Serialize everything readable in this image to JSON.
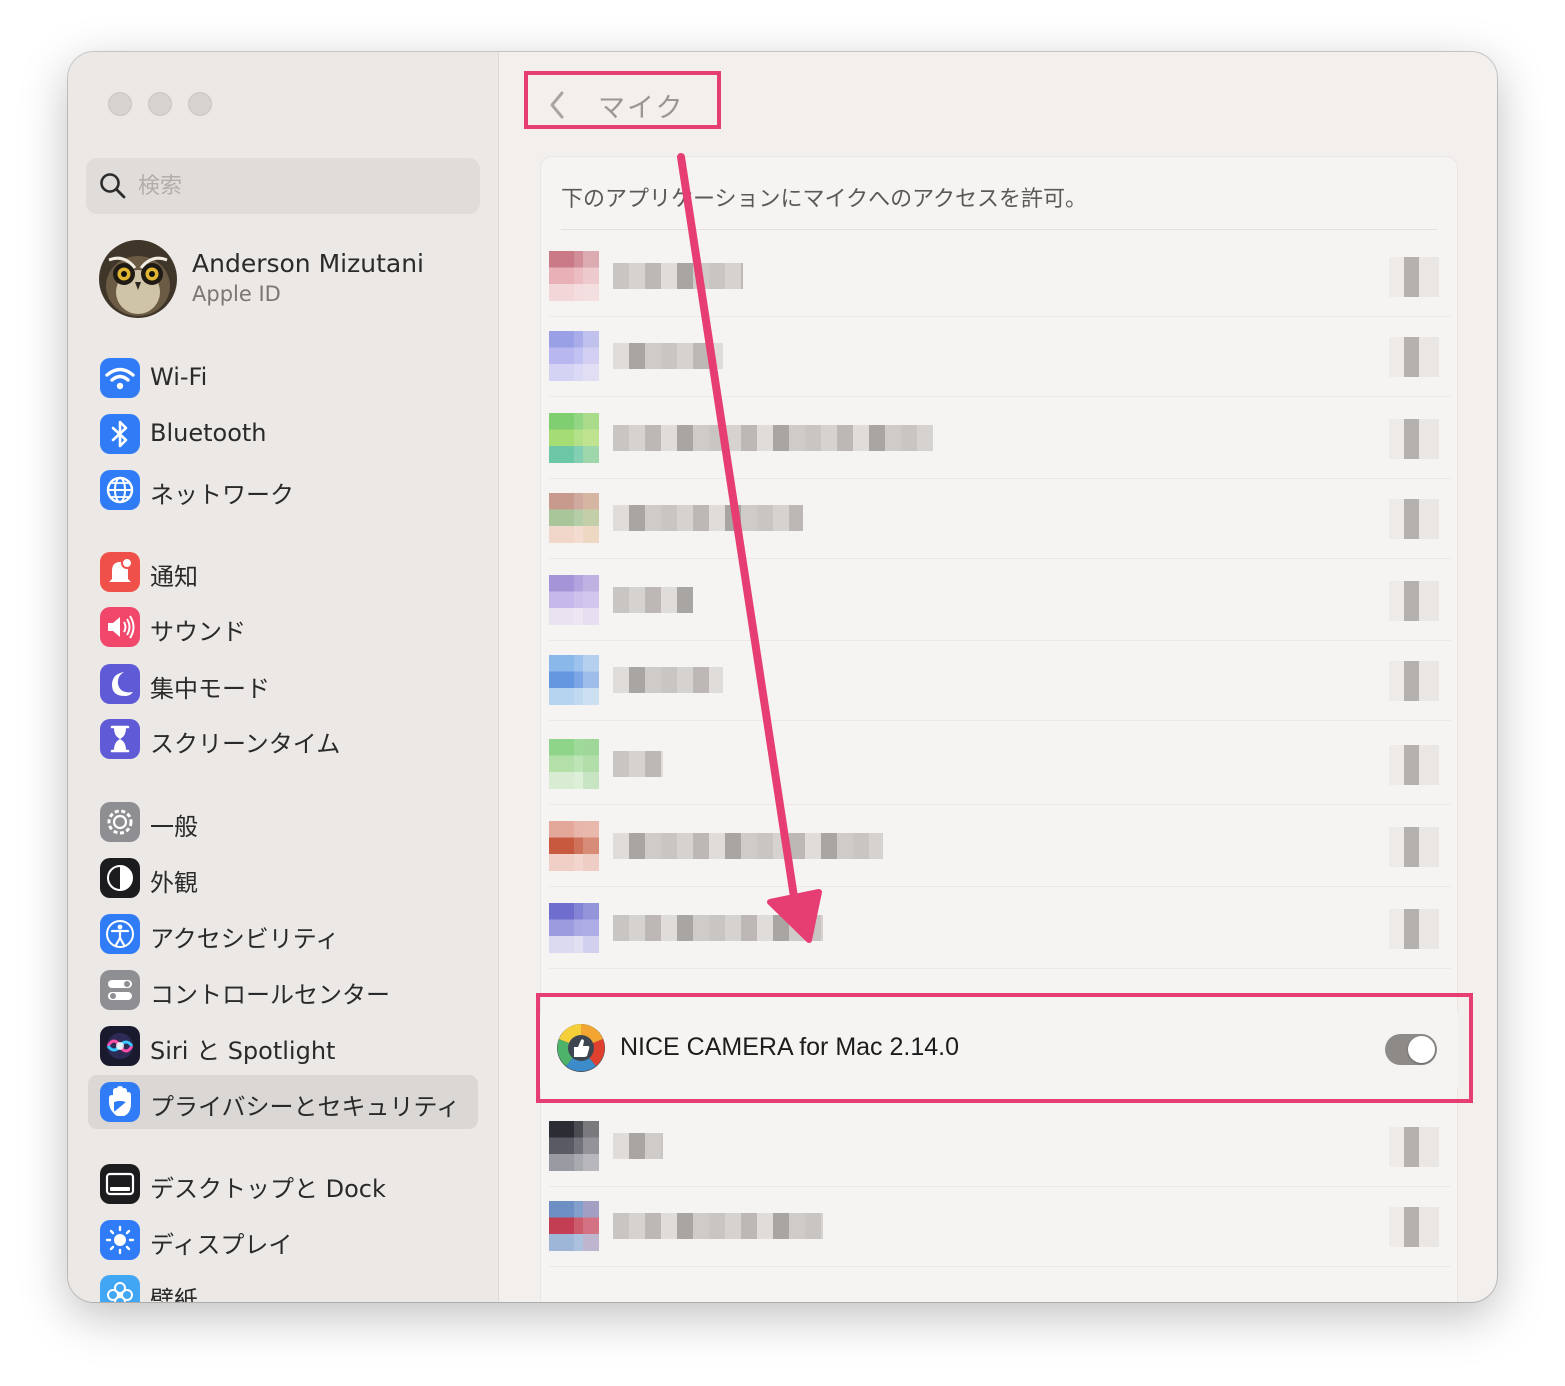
{
  "sidebar": {
    "search_placeholder": "検索",
    "account": {
      "name": "Anderson Mizutani",
      "subtitle": "Apple ID"
    },
    "items": [
      {
        "label": "Wi-Fi",
        "icon": "wifi-icon",
        "color": "#2f7cf6"
      },
      {
        "label": "Bluetooth",
        "icon": "bluetooth-icon",
        "color": "#2f7cf6"
      },
      {
        "label": "ネットワーク",
        "icon": "globe-icon",
        "color": "#2f7cf6"
      },
      {
        "label": "通知",
        "icon": "bell-icon",
        "color": "#f0504a"
      },
      {
        "label": "サウンド",
        "icon": "speaker-icon",
        "color": "#f0476a"
      },
      {
        "label": "集中モード",
        "icon": "moon-icon",
        "color": "#5f5bd6"
      },
      {
        "label": "スクリーンタイム",
        "icon": "hourglass-icon",
        "color": "#5f5bd6"
      },
      {
        "label": "一般",
        "icon": "gear-icon",
        "color": "#8e8e93"
      },
      {
        "label": "外観",
        "icon": "appearance-icon",
        "color": "#1c1c1e"
      },
      {
        "label": "アクセシビリティ",
        "icon": "accessibility-icon",
        "color": "#2f7cf6"
      },
      {
        "label": "コントロールセンター",
        "icon": "control-center-icon",
        "color": "#8e8e93"
      },
      {
        "label": "Siri と Spotlight",
        "icon": "siri-icon",
        "color": "#3a2f6f"
      },
      {
        "label": "プライバシーとセキュリティ",
        "icon": "hand-icon",
        "color": "#2f7cf6",
        "selected": true
      },
      {
        "label": "デスクトップと Dock",
        "icon": "dock-icon",
        "color": "#1c1c1e"
      },
      {
        "label": "ディスプレイ",
        "icon": "sun-icon",
        "color": "#2f7cf6"
      },
      {
        "label": "壁紙",
        "icon": "flower-icon",
        "color": "#41a7f5"
      }
    ]
  },
  "main": {
    "title": "マイク",
    "description": "下のアプリケーションにマイクへのアクセスを許可。",
    "highlighted_app": {
      "name": "NICE CAMERA for Mac 2.14.0",
      "enabled": false
    }
  },
  "colors": {
    "annotation": "#e63e73",
    "toggle_off": "#8d8a88",
    "selected_bg": "#dad7d4"
  }
}
